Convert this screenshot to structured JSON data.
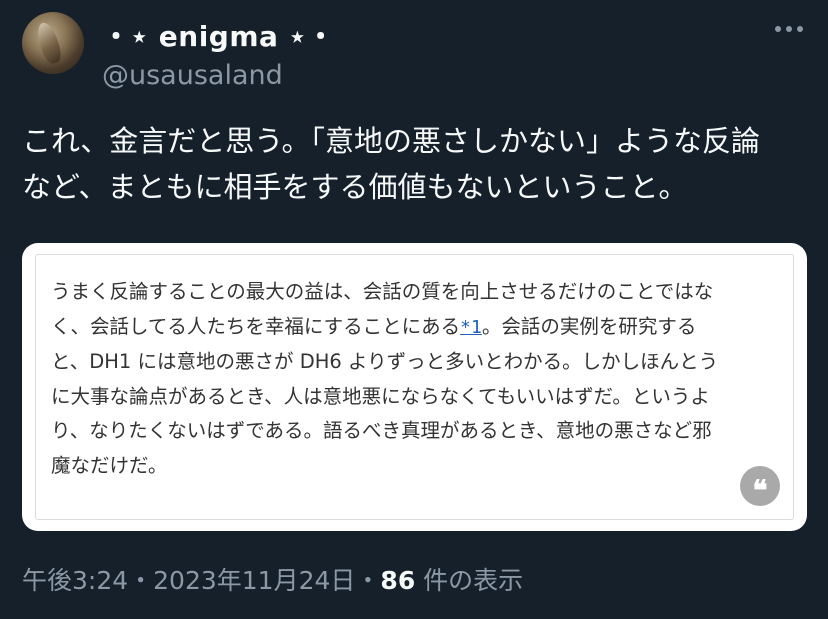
{
  "author": {
    "display_name": "・⋆ enigma ⋆・",
    "handle": "@usausaland"
  },
  "more_icon": "more-horizontal-icon",
  "tweet": {
    "lines": [
      "これ、金言だと思う。「意地の悪さしかない」ような反論",
      "など、まともに相手をする価値もないということ。"
    ]
  },
  "quote": {
    "line1": "うまく反論することの最大の益は、会話の質を向上させるだけのことではな",
    "line2_before": "く、会話してる人たちを幸福にすることにある",
    "line2_link": "*1",
    "line2_after": "。会話の実例を研究する",
    "line3": "と、DH1 には意地の悪さが DH6 よりずっと多いとわかる。しかしほんとう",
    "line4": "に大事な論点があるとき、人は意地悪にならなくてもいいはずだ。というよ",
    "line5": "り、なりたくないはずである。語るべき真理があるとき、意地の悪さなど邪",
    "line6": "魔なだけだ。",
    "quote_icon": "quote-mark-icon",
    "quote_glyph": "❝"
  },
  "meta": {
    "time": "午後3:24",
    "sep1": "・",
    "date": "2023年11月24日",
    "sep2": "・",
    "views_count": "86",
    "views_label": " 件の表示"
  }
}
